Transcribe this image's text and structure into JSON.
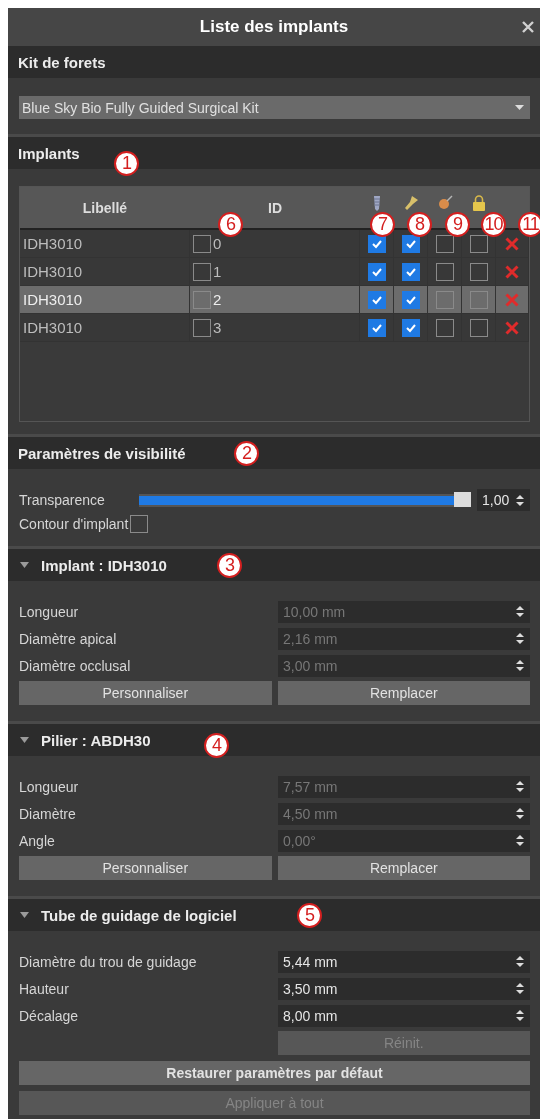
{
  "window": {
    "title": "Liste des implants"
  },
  "drill_kit": {
    "title": "Kit de forets",
    "dropdown": {
      "value": "Blue Sky Bio Fully Guided Surgical Kit"
    }
  },
  "implants": {
    "title": "Implants",
    "callout": "1",
    "table": {
      "columns": [
        "Libellé",
        "ID"
      ],
      "callouts": [
        "6",
        "7",
        "8",
        "9",
        "10",
        "11"
      ],
      "rows": [
        {
          "label": "IDH3010",
          "id": "0",
          "id_checked": false,
          "checks": [
            true,
            true,
            false,
            false
          ],
          "selected": false
        },
        {
          "label": "IDH3010",
          "id": "1",
          "id_checked": false,
          "checks": [
            true,
            true,
            false,
            false
          ],
          "selected": false
        },
        {
          "label": "IDH3010",
          "id": "2",
          "id_checked": false,
          "checks": [
            true,
            true,
            false,
            false
          ],
          "selected": true
        },
        {
          "label": "IDH3010",
          "id": "3",
          "id_checked": false,
          "checks": [
            true,
            true,
            false,
            false
          ],
          "selected": false
        }
      ]
    }
  },
  "visibility": {
    "title": "Paramètres de visibilité",
    "callout": "2",
    "transparency": {
      "label": "Transparence",
      "level": 1,
      "reading": "1,00"
    },
    "outline": {
      "label": "Contour d'implant",
      "checked": false
    }
  },
  "parameter_groups": [
    {
      "title": "Implant : IDH3010",
      "callout": "3",
      "expanded": true,
      "fields": [
        {
          "label": "Longueur",
          "value": "10,00 mm",
          "disabled": true
        },
        {
          "label": "Diamètre apical",
          "value": "2,16 mm",
          "disabled": true
        },
        {
          "label": "Diamètre occlusal",
          "value": "3,00 mm",
          "disabled": true
        }
      ],
      "buttons": [
        {
          "label": "Personnaliser",
          "kind": "left",
          "disabled": false,
          "bold": false
        },
        {
          "label": "Remplacer",
          "kind": "right",
          "disabled": false,
          "bold": false
        }
      ]
    },
    {
      "title": "Pilier : ABDH30",
      "callout": "4",
      "expanded": true,
      "fields": [
        {
          "label": "Longueur",
          "value": "7,57 mm",
          "disabled": true
        },
        {
          "label": "Diamètre",
          "value": "4,50 mm",
          "disabled": true
        },
        {
          "label": "Angle",
          "value": "0,00°",
          "disabled": true
        }
      ],
      "buttons": [
        {
          "label": "Personnaliser",
          "kind": "left",
          "disabled": false,
          "bold": false
        },
        {
          "label": "Remplacer",
          "kind": "right",
          "disabled": false,
          "bold": false
        }
      ]
    },
    {
      "title": "Tube de guidage de logiciel",
      "callout": "5",
      "expanded": true,
      "fields": [
        {
          "label": "Diamètre du trou de guidage",
          "value": "5,44 mm",
          "disabled": false
        },
        {
          "label": "Hauteur",
          "value": "3,50 mm",
          "disabled": false
        },
        {
          "label": "Décalage",
          "value": "8,00 mm",
          "disabled": false
        }
      ],
      "buttons": [
        {
          "label": "Réinit.",
          "kind": "right",
          "disabled": true,
          "bold": false
        },
        {
          "label": "Restaurer paramètres par défaut",
          "kind": "full",
          "disabled": false,
          "bold": true
        },
        {
          "label": "Appliquer à tout",
          "kind": "full",
          "disabled": true,
          "bold": false
        }
      ]
    }
  ]
}
